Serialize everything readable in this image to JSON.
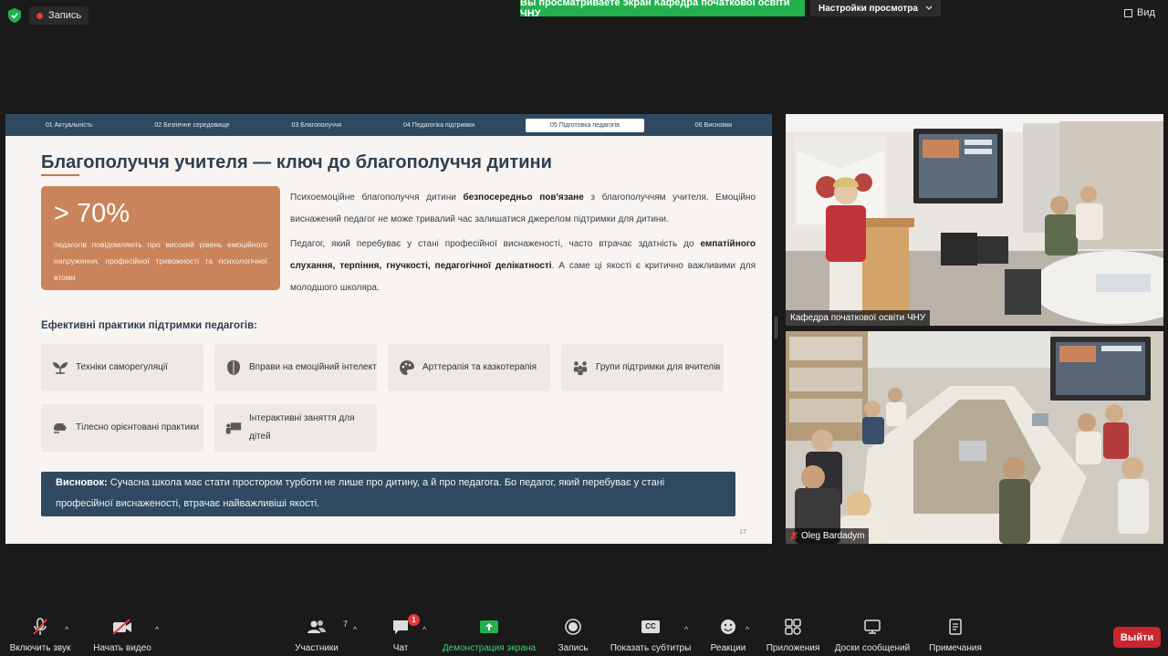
{
  "top": {
    "record_label": "Запись",
    "share_banner": "Вы просматриваете экран Кафедра початкової освіти ЧНУ",
    "view_settings": "Настройки просмотра",
    "view_label": "Вид"
  },
  "slide": {
    "nav_tabs": [
      "01 Актуальність",
      "02 Безпечне середовище",
      "03 Благополуччя",
      "04 Педагогіка підтримки",
      "05 Підготовка педагогів",
      "06 Висновки"
    ],
    "active_tab_index": 4,
    "title": "Благополуччя учителя — ключ до благополуччя дитини",
    "stat_value": "> 70%",
    "stat_desc": "педагогів повідомляють про високий рівень емоційного напруження, професійної тривожності та психологічної втоми",
    "p1_a": "Психоемоційне благополуччя дитини ",
    "p1_b": "безпосередньо пов'язане",
    "p1_c": " з благополуччям учителя. Емоційно виснажений педагог не може тривалий час залишатися джерелом підтримки для дитини.",
    "p2_a": "Педагог, який перебуває у стані професійної виснаженості, часто втрачає здатність до ",
    "p2_b": "емпатійного слухання, терпіння, гнучкості, педагогічної делікатності",
    "p2_c": ". А саме ці якості є критично важливими для молодшого школяра.",
    "practices_title": "Ефективні практики підтримки педагогів:",
    "practices": [
      {
        "label": "Техніки саморегуляції",
        "icon": "seedling-icon"
      },
      {
        "label": "Вправи на емоційний інтелект",
        "icon": "brain-icon"
      },
      {
        "label": "Арттерапія та казкотерапія",
        "icon": "palette-icon"
      },
      {
        "label": "Групи підтримки для вчителів",
        "icon": "people-icon"
      },
      {
        "label": "Тілесно орієнтовані практики",
        "icon": "hand-icon"
      },
      {
        "label": "Інтерактивні заняття для дітей",
        "icon": "teacher-board-icon"
      }
    ],
    "conclusion_label": "Висновок:",
    "conclusion_text": " Сучасна школа має стати простором турботи не лише про дитину, а й про педагога. Бо педагог, який перебуває у стані професійної виснаженості, втрачає найважливіші якості.",
    "page_number": "17"
  },
  "videos": [
    {
      "name": "Кафедра початкової освіти ЧНУ",
      "muted": false
    },
    {
      "name": "Oleg Bardadym",
      "muted": true
    }
  ],
  "toolbar": {
    "audio": "Включить звук",
    "video": "Начать видео",
    "participants": "Участники",
    "participants_count": "7",
    "chat": "Чат",
    "chat_badge": "1",
    "share": "Демонстрация экрана",
    "record": "Запись",
    "captions": "Показать субтитры",
    "captions_icon_text": "CC",
    "reactions": "Реакции",
    "apps": "Приложения",
    "whiteboards": "Доски сообщений",
    "notes": "Примечания",
    "leave": "Выйти"
  },
  "colors": {
    "share_green": "#22b14c",
    "leave_red": "#c9262f",
    "slide_navy": "#2f4a60",
    "stat_orange": "#c9845b"
  }
}
